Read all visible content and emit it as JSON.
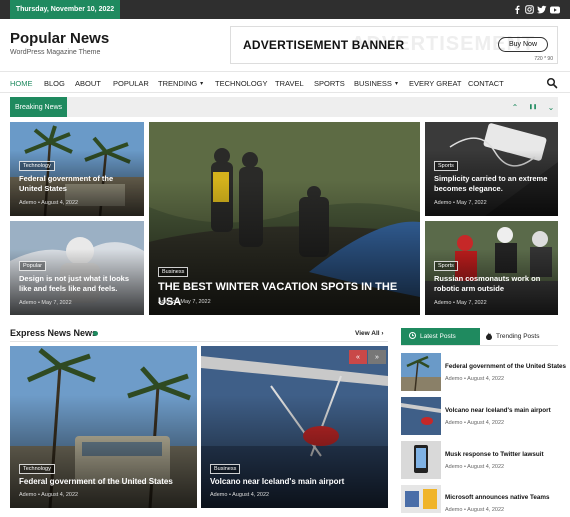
{
  "topbar": {
    "date": "Thursday, November 10, 2022",
    "social": [
      "facebook-icon",
      "instagram-icon",
      "twitter-icon",
      "youtube-icon"
    ]
  },
  "header": {
    "site_title": "Popular News",
    "tagline": "WordPress Magazine Theme"
  },
  "ad": {
    "title": "ADVERTISEMENT BANNER",
    "ghost": "ADVERTISEMENT",
    "button": "Buy Now",
    "size": "720 * 90"
  },
  "nav": {
    "items": [
      {
        "label": "HOME",
        "dropdown": false
      },
      {
        "label": "BLOG",
        "dropdown": false
      },
      {
        "label": "ABOUT",
        "dropdown": false
      },
      {
        "label": "POPULAR",
        "dropdown": false
      },
      {
        "label": "TRENDING",
        "dropdown": true
      },
      {
        "label": "TECHNOLOGY",
        "dropdown": false
      },
      {
        "label": "TRAVEL",
        "dropdown": false
      },
      {
        "label": "SPORTS",
        "dropdown": false
      },
      {
        "label": "BUSINESS",
        "dropdown": true
      },
      {
        "label": "EVERY GREAT",
        "dropdown": false
      },
      {
        "label": "CONTACT",
        "dropdown": false
      }
    ],
    "chevron": "▾"
  },
  "ticker": {
    "label": "Breaking News",
    "up": "⌃",
    "pause": "❚❚",
    "down": "⌄"
  },
  "grid": [
    {
      "category": "Technology",
      "title": "Federal government of the United States",
      "meta": "Ademo • August 4, 2022"
    },
    {
      "category": "Business",
      "title": "THE BEST WINTER VACATION SPOTS IN THE USA",
      "meta": "Ademo • May 7, 2022"
    },
    {
      "category": "Sports",
      "title": "Simplicity carried to an extreme becomes elegance.",
      "meta": "Ademo • May 7, 2022"
    },
    {
      "category": "Popular",
      "title": "Design is not just what it looks like and feels like and feels.",
      "meta": "Ademo • May 7, 2022"
    },
    {
      "category": "Sports",
      "title": "Russian cosmonauts work on robotic arm outside",
      "meta": "Ademo • May 7, 2022"
    }
  ],
  "express": {
    "title": "Express News News",
    "view_all": "View All",
    "cards": [
      {
        "category": "Technology",
        "title": "Federal government of the United States",
        "meta": "Ademo • August 4, 2022"
      },
      {
        "category": "Business",
        "title": "Volcano near Iceland's main airport",
        "meta": "Ademo • August 4, 2022"
      }
    ],
    "arrows": [
      "«",
      "»"
    ]
  },
  "sidebar": {
    "tab_latest": "Latest Posts",
    "tab_trending": "Trending Posts",
    "posts": [
      {
        "title": "Federal government of the United States",
        "meta": "Ademo • August 4, 2022"
      },
      {
        "title": "Volcano near Iceland's main airport",
        "meta": "Ademo • August 4, 2022"
      },
      {
        "title": "Musk response to Twitter lawsuit",
        "meta": "Ademo • August 4, 2022"
      },
      {
        "title": "Microsoft announces native Teams",
        "meta": "Ademo • August 4, 2022"
      }
    ]
  },
  "colors": {
    "accent": "#1f8a5f",
    "topbar": "#2f2f2f",
    "slider_arrow": "#c94848"
  }
}
